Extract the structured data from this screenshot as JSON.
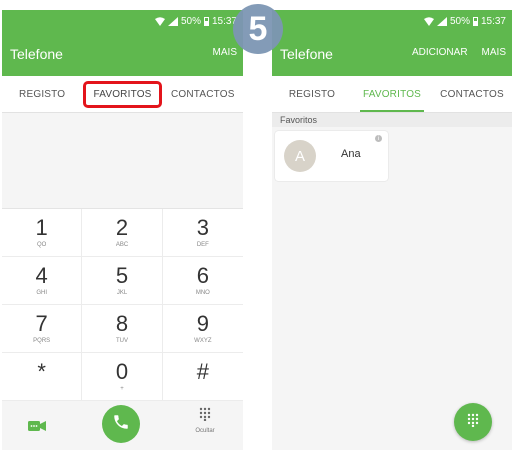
{
  "status_bar": {
    "battery": "50%",
    "time": "15:37"
  },
  "left": {
    "app_title": "Telefone",
    "actions": [
      "MAIS"
    ],
    "tabs": [
      "REGISTO",
      "FAVORITOS",
      "CONTACTOS"
    ],
    "keys": [
      {
        "digit": "1",
        "letters": "QO"
      },
      {
        "digit": "2",
        "letters": "ABC"
      },
      {
        "digit": "3",
        "letters": "DEF"
      },
      {
        "digit": "4",
        "letters": "GHI"
      },
      {
        "digit": "5",
        "letters": "JKL"
      },
      {
        "digit": "6",
        "letters": "MNO"
      },
      {
        "digit": "7",
        "letters": "PQRS"
      },
      {
        "digit": "8",
        "letters": "TUV"
      },
      {
        "digit": "9",
        "letters": "WXYZ"
      },
      {
        "digit": "*",
        "letters": ""
      },
      {
        "digit": "0",
        "letters": "+"
      },
      {
        "digit": "#",
        "letters": ""
      }
    ],
    "hide_label": "Ocultar"
  },
  "right": {
    "app_title": "Telefone",
    "actions": [
      "ADICIONAR",
      "MAIS"
    ],
    "tabs": [
      "REGISTO",
      "FAVORITOS",
      "CONTACTOS"
    ],
    "section_header": "Favoritos",
    "favorite": {
      "initial": "A",
      "name": "Ana"
    }
  },
  "step_badge": "5",
  "colors": {
    "accent": "#5fb84e",
    "highlight": "#e3141b",
    "badge": "#7d96b4"
  },
  "icons": {
    "video_call": "video-call-icon",
    "call": "phone-icon",
    "keypad": "dialpad-icon",
    "signal": "signal-icon",
    "battery": "battery-icon",
    "info": "info-icon"
  }
}
